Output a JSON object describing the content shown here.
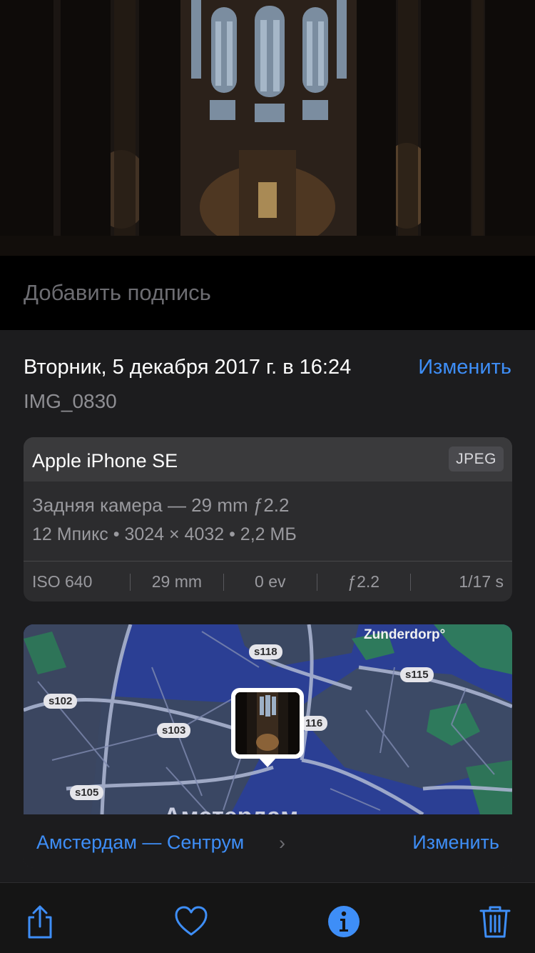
{
  "caption": {
    "placeholder": "Добавить подпись"
  },
  "details": {
    "date": "Вторник, 5 декабря 2017 г. в 16:24",
    "edit_label": "Изменить",
    "filename": "IMG_0830"
  },
  "camera": {
    "device": "Apple iPhone SE",
    "format": "JPEG",
    "lens": "Задняя камера — 29 mm ƒ2.2",
    "specs": "12 Мпикс  •  3024 × 4032  •  2,2 МБ",
    "exif": [
      "ISO 640",
      "29 mm",
      "0 ev",
      "ƒ2.2",
      "1/17 s"
    ]
  },
  "map": {
    "roads": [
      "s118",
      "s115",
      "s102",
      "s103",
      "116",
      "s105"
    ],
    "places": [
      "Zunderdorp°",
      "Амстердам"
    ],
    "location": "Амстердам — Сентрум",
    "edit_label": "Изменить"
  },
  "toolbar": {
    "icons": [
      "share-icon",
      "heart-icon",
      "info-icon",
      "trash-icon"
    ],
    "accent": "#3e8ef7"
  }
}
